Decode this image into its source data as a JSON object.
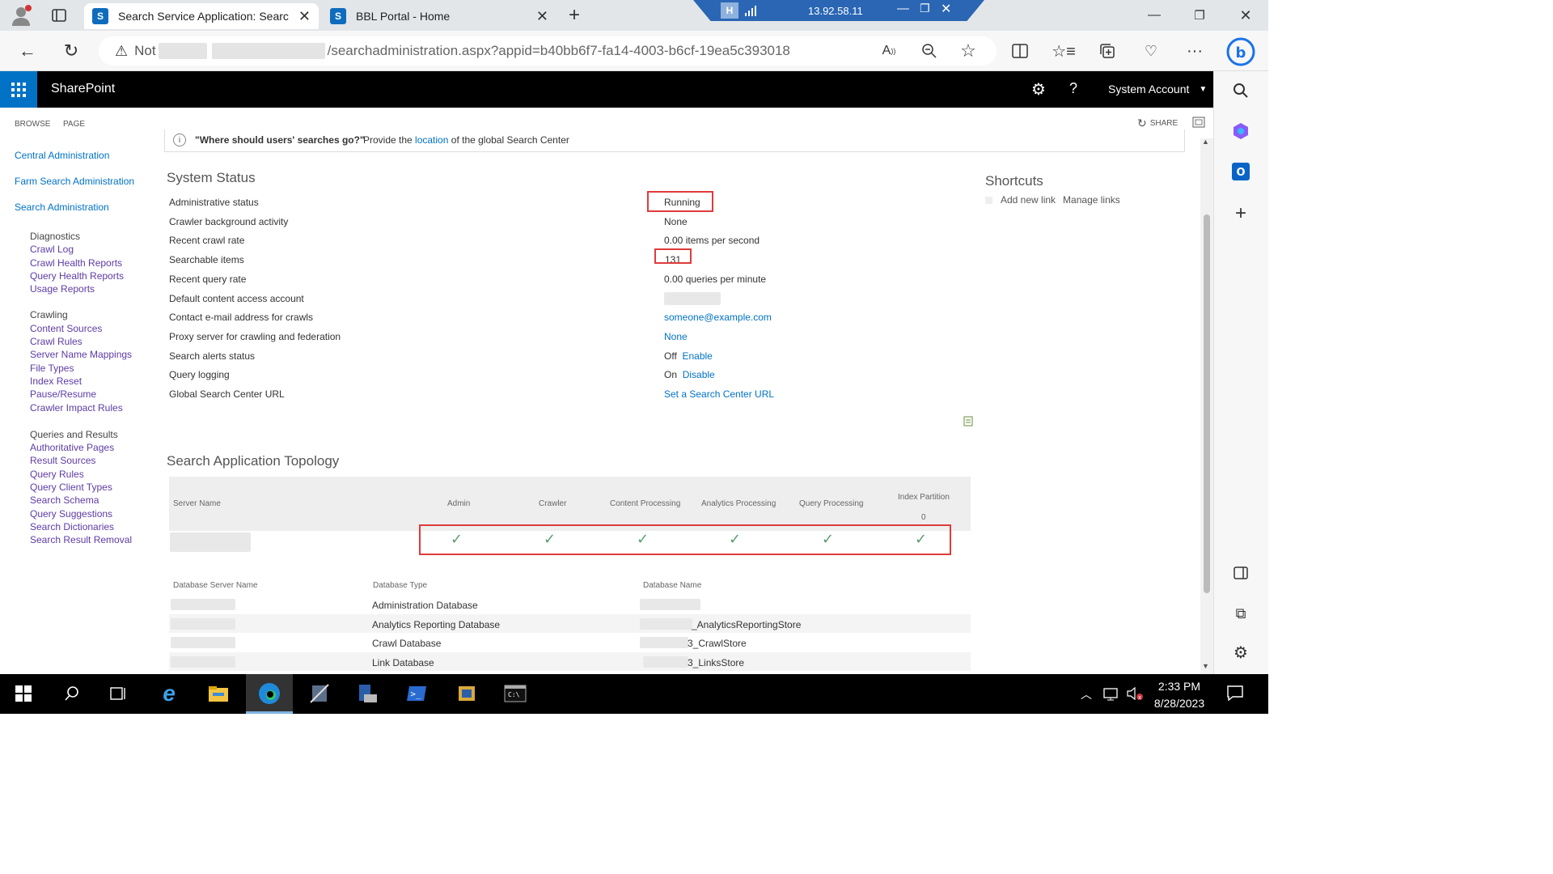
{
  "browser": {
    "tabs": [
      {
        "title": "Search Service Application: Searc",
        "active": true,
        "icon": "sharepoint-icon"
      },
      {
        "title": "BBL Portal - Home",
        "active": false,
        "icon": "sharepoint-icon"
      }
    ],
    "rdp_ip": "13.92.58.11",
    "url_prefix": "Not",
    "url_path": "/searchadministration.aspx?appid=b40bb6f7-fa14-4003-b6cf-19ea5c393018"
  },
  "suitebar": {
    "brand": "SharePoint",
    "help": "?",
    "account": "System Account"
  },
  "ribbon": {
    "browse": "BROWSE",
    "page": "PAGE",
    "share": "SHARE"
  },
  "leftnav": {
    "top_links": [
      "Central Administration",
      "Farm Search Administration",
      "Search Administration"
    ],
    "groups": [
      {
        "heading": "Diagnostics",
        "links": [
          "Crawl Log",
          "Crawl Health Reports",
          "Query Health Reports",
          "Usage Reports"
        ]
      },
      {
        "heading": "Crawling",
        "links": [
          "Content Sources",
          "Crawl Rules",
          "Server Name Mappings",
          "File Types",
          "Index Reset",
          "Pause/Resume",
          "Crawler Impact Rules"
        ]
      },
      {
        "heading": "Queries and Results",
        "links": [
          "Authoritative Pages",
          "Result Sources",
          "Query Rules",
          "Query Client Types",
          "Search Schema",
          "Query Suggestions",
          "Search Dictionaries",
          "Search Result Removal"
        ]
      }
    ]
  },
  "notice": {
    "question": "\"Where should users' searches go?\"",
    "pre": "Provide the",
    "link": "location",
    "post": "of the global Search Center"
  },
  "status": {
    "title": "System Status",
    "rows": [
      {
        "label": "Administrative status",
        "value": "Running",
        "link": ""
      },
      {
        "label": "Crawler background activity",
        "value": "None",
        "link": ""
      },
      {
        "label": "Recent crawl rate",
        "value": "0.00 items per second",
        "link": ""
      },
      {
        "label": "Searchable items",
        "value": "131",
        "link": ""
      },
      {
        "label": "Recent query rate",
        "value": "0.00 queries per minute",
        "link": ""
      },
      {
        "label": "Default content access account",
        "value": "",
        "link": ""
      },
      {
        "label": "Contact e-mail address for crawls",
        "value": "",
        "link": "someone@example.com"
      },
      {
        "label": "Proxy server for crawling and federation",
        "value": "",
        "link": "None"
      },
      {
        "label": "Search alerts status",
        "value": "Off",
        "link": "Enable"
      },
      {
        "label": "Query logging",
        "value": "On",
        "link": "Disable"
      },
      {
        "label": "Global Search Center URL",
        "value": "",
        "link": "Set a Search Center URL"
      }
    ]
  },
  "shortcuts": {
    "title": "Shortcuts",
    "add": "Add new link",
    "manage": "Manage links"
  },
  "topology": {
    "title": "Search Application Topology",
    "headers": [
      "Server Name",
      "Admin",
      "Crawler",
      "Content Processing",
      "Analytics Processing",
      "Query Processing",
      "Index Partition"
    ],
    "partition": "0",
    "check": "✓",
    "db_headers": [
      "Database Server Name",
      "Database Type",
      "Database Name"
    ],
    "databases": [
      {
        "type": "Administration Database",
        "name": ""
      },
      {
        "type": "Analytics Reporting Database",
        "name": "_AnalyticsReportingStore"
      },
      {
        "type": "Crawl Database",
        "name": "3_CrawlStore"
      },
      {
        "type": "Link Database",
        "name": "3_LinksStore"
      }
    ]
  },
  "taskbar": {
    "time": "2:33 PM",
    "date": "8/28/2023"
  }
}
